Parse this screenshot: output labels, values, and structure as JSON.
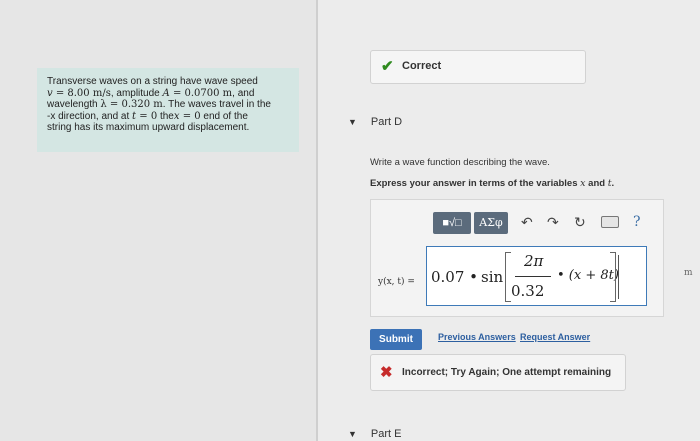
{
  "problem": {
    "l1a": "Transverse waves on a string have wave speed",
    "l2a": "v",
    "l2b": " = 8.00 m/s",
    "l2c": ", amplitude ",
    "l2d": "A",
    "l2e": " = 0.0700 m",
    "l2f": ", and",
    "l3a": "wavelength ",
    "l3b": "λ",
    "l3c": " = 0.320 m",
    "l3d": ". The waves travel in the",
    "l4a": "-x direction, and at ",
    "l4b": "t",
    "l4c": " = 0",
    "l4d": " the",
    "l4e": "x",
    "l4f": " = 0",
    "l4g": " end of the",
    "l5a": "string has its maximum upward displacement."
  },
  "feedback_correct": {
    "icon": "check-icon",
    "text": "Correct"
  },
  "part_d": {
    "label": "Part D",
    "instruction": "Write a wave function describing the wave.",
    "express_prefix": "Express your answer in terms of the variables ",
    "var_x": "x",
    "and": " and ",
    "var_t": "t",
    "period": "."
  },
  "toolbar": {
    "template": "■√□",
    "greek": "AΣφ",
    "undo": "↶",
    "redo": "↷",
    "reset": "↻",
    "help": "?"
  },
  "answer": {
    "lhs": "y(x, t) =",
    "coef": "0.07 •",
    "sin": "sin",
    "num": "2π",
    "den": "0.32",
    "tail": "• (x + 8t)"
  },
  "side_mark": "m",
  "actions": {
    "submit": "Submit",
    "previous": "Previous Answers",
    "request": "Request Answer"
  },
  "feedback_incorrect": {
    "icon": "x-icon",
    "text": "Incorrect; Try Again; One attempt remaining"
  },
  "part_e": {
    "label": "Part E"
  },
  "colors": {
    "accent": "#3c72b6",
    "correct": "#2f8a1f",
    "incorrect": "#c62b2b",
    "problem_bg": "#d4e6e3"
  }
}
